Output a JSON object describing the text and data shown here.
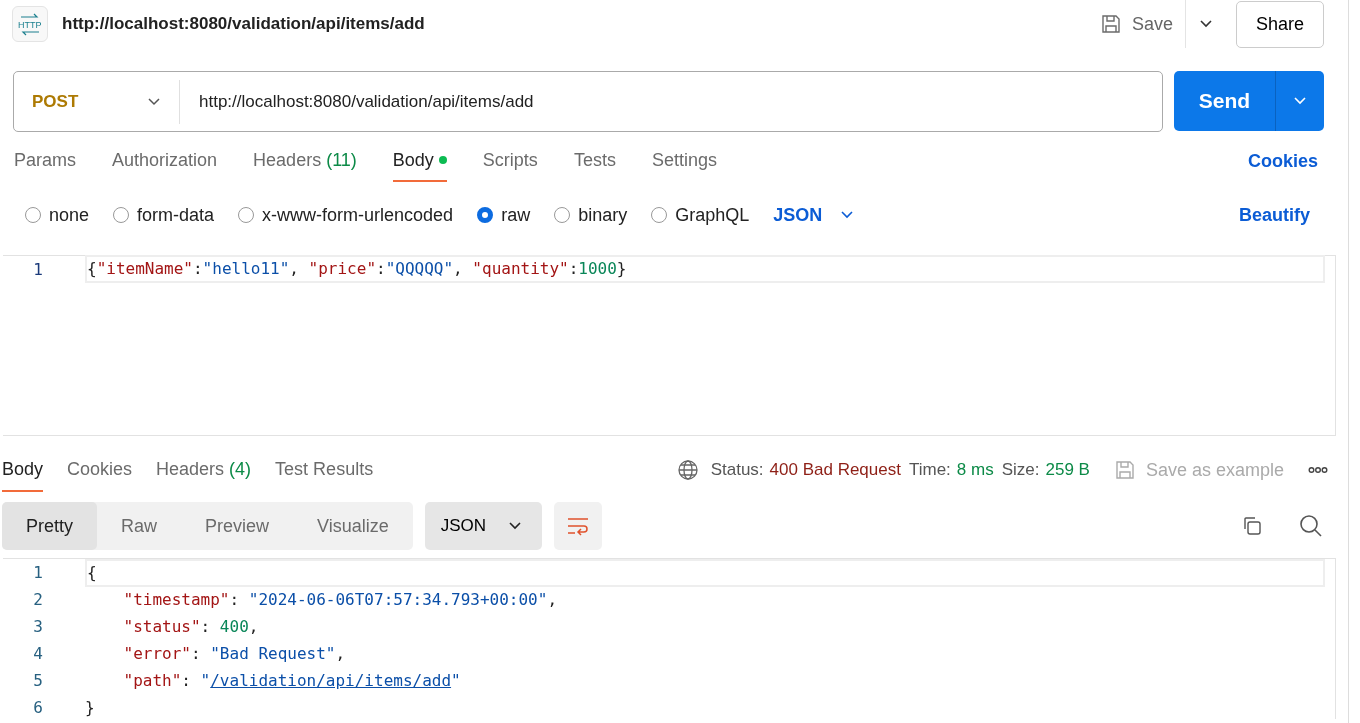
{
  "header": {
    "logo_text": "HTTP",
    "title": "http://localhost:8080/validation/api/items/add",
    "save": "Save",
    "share": "Share"
  },
  "request": {
    "method": "POST",
    "url": "http://localhost:8080/validation/api/items/add",
    "send": "Send"
  },
  "request_tabs": [
    {
      "label": "Params",
      "dot": false,
      "selected": false
    },
    {
      "label": "Authorization",
      "dot": false,
      "selected": false
    },
    {
      "label": "Headers",
      "count": "(11)",
      "dot": false,
      "selected": false
    },
    {
      "label": "Body",
      "dot": true,
      "selected": true
    },
    {
      "label": "Scripts",
      "dot": false,
      "selected": false
    },
    {
      "label": "Tests",
      "dot": false,
      "selected": false
    },
    {
      "label": "Settings",
      "dot": false,
      "selected": false
    }
  ],
  "cookies_link": "Cookies",
  "body_types": [
    {
      "label": "none",
      "selected": false
    },
    {
      "label": "form-data",
      "selected": false
    },
    {
      "label": "x-www-form-urlencoded",
      "selected": false
    },
    {
      "label": "raw",
      "selected": true
    },
    {
      "label": "binary",
      "selected": false
    },
    {
      "label": "GraphQL",
      "selected": false
    }
  ],
  "body_format": "JSON",
  "beautify": "Beautify",
  "request_body": [
    {
      "number": "1",
      "tokens": [
        {
          "kind": "punct",
          "text": "{"
        },
        {
          "kind": "key",
          "text": "\"itemName\""
        },
        {
          "kind": "punct",
          "text": ":"
        },
        {
          "kind": "string",
          "text": "\"hello11\""
        },
        {
          "kind": "punct",
          "text": ", "
        },
        {
          "kind": "key",
          "text": "\"price\""
        },
        {
          "kind": "punct",
          "text": ":"
        },
        {
          "kind": "string",
          "text": "\"QQQQQ\""
        },
        {
          "kind": "punct",
          "text": ", "
        },
        {
          "kind": "key",
          "text": "\"quantity\""
        },
        {
          "kind": "punct",
          "text": ":"
        },
        {
          "kind": "number",
          "text": "1000"
        },
        {
          "kind": "punct",
          "text": "}"
        }
      ]
    }
  ],
  "response_tabs": [
    {
      "label": "Body",
      "selected": true
    },
    {
      "label": "Cookies",
      "selected": false
    },
    {
      "label": "Headers",
      "count": "(4)",
      "selected": false
    },
    {
      "label": "Test Results",
      "selected": false
    }
  ],
  "response_meta": {
    "status_label": "Status:",
    "status": "400 Bad Request",
    "time_label": "Time:",
    "time": "8 ms",
    "size_label": "Size:",
    "size": "259 B",
    "save_example": "Save as example"
  },
  "view_modes": [
    {
      "label": "Pretty",
      "selected": true
    },
    {
      "label": "Raw",
      "selected": false
    },
    {
      "label": "Preview",
      "selected": false
    },
    {
      "label": "Visualize",
      "selected": false
    }
  ],
  "response_format": "JSON",
  "response_body": [
    {
      "number": "1",
      "tokens": [
        {
          "kind": "punct",
          "text": "{"
        }
      ]
    },
    {
      "number": "2",
      "tokens": [
        {
          "kind": "key",
          "text": "    \"timestamp\""
        },
        {
          "kind": "punct",
          "text": ": "
        },
        {
          "kind": "string",
          "text": "\"2024-06-06T07:57:34.793+00:00\""
        },
        {
          "kind": "punct",
          "text": ","
        }
      ]
    },
    {
      "number": "3",
      "tokens": [
        {
          "kind": "key",
          "text": "    \"status\""
        },
        {
          "kind": "punct",
          "text": ": "
        },
        {
          "kind": "number",
          "text": "400"
        },
        {
          "kind": "punct",
          "text": ","
        }
      ]
    },
    {
      "number": "4",
      "tokens": [
        {
          "kind": "key",
          "text": "    \"error\""
        },
        {
          "kind": "punct",
          "text": ": "
        },
        {
          "kind": "string",
          "text": "\"Bad Request\""
        },
        {
          "kind": "punct",
          "text": ","
        }
      ]
    },
    {
      "number": "5",
      "tokens": [
        {
          "kind": "key",
          "text": "    \"path\""
        },
        {
          "kind": "punct",
          "text": ": "
        },
        {
          "kind": "string",
          "text": "\""
        },
        {
          "kind": "link",
          "text": "/validation/api/items/add"
        },
        {
          "kind": "string",
          "text": "\""
        }
      ]
    },
    {
      "number": "6",
      "tokens": [
        {
          "kind": "punct",
          "text": "}"
        }
      ]
    }
  ]
}
